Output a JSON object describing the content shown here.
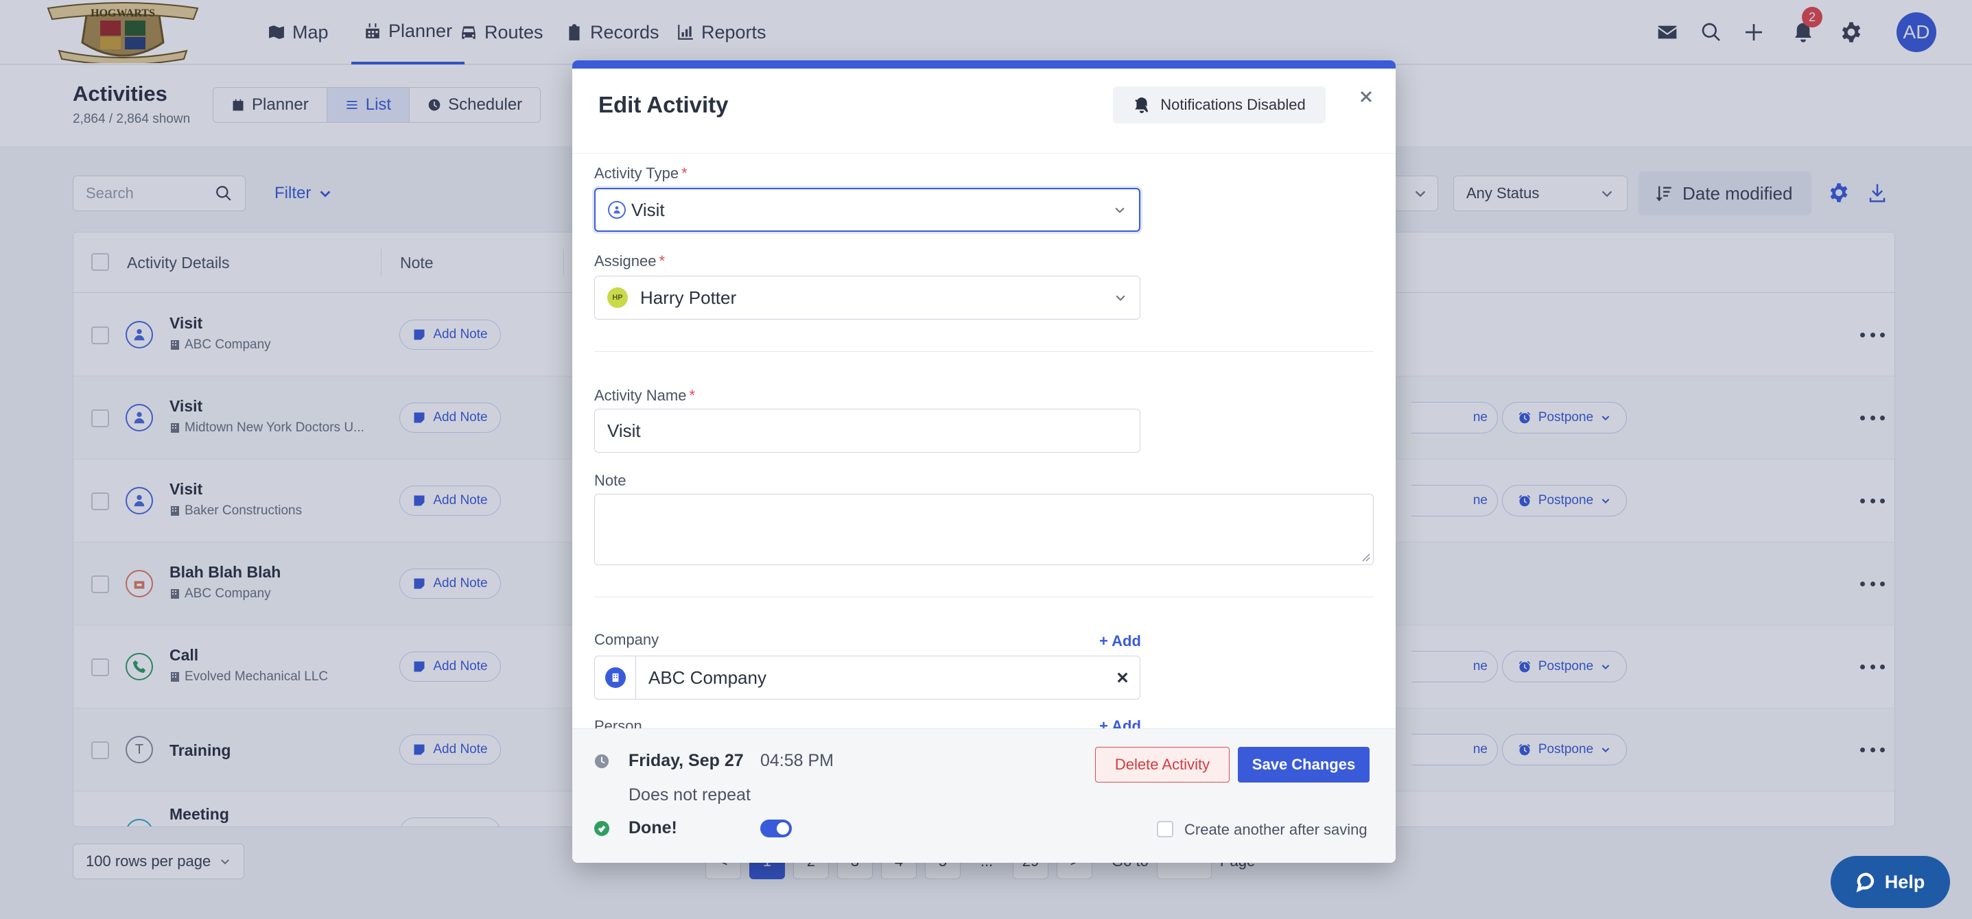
{
  "nav": {
    "items": [
      {
        "label": "Map",
        "icon": "map-icon"
      },
      {
        "label": "Planner",
        "icon": "calendar-icon",
        "active": true
      },
      {
        "label": "Routes",
        "icon": "car-icon"
      },
      {
        "label": "Records",
        "icon": "clipboard-icon"
      },
      {
        "label": "Reports",
        "icon": "chart-icon"
      }
    ],
    "notification_count": "2",
    "avatar_initials": "AD",
    "logo_text": "HOGWARTS"
  },
  "page": {
    "title": "Activities",
    "subtitle": "2,864 / 2,864 shown",
    "view_tabs": [
      {
        "label": "Planner",
        "icon": "calendar-icon"
      },
      {
        "label": "List",
        "icon": "list-icon",
        "active": true
      },
      {
        "label": "Scheduler",
        "icon": "clock-icon"
      }
    ]
  },
  "toolbar": {
    "search_placeholder": "Search",
    "filter_label": "Filter",
    "status_select": "Any Status",
    "sort_label": "Date modified"
  },
  "table": {
    "columns": [
      "Activity Details",
      "Note"
    ],
    "add_note_label": "Add Note",
    "done_partial": "ne",
    "postpone_label": "Postpone",
    "rows": [
      {
        "title": "Visit",
        "company": "ABC Company",
        "icon": "person-icon",
        "actions": false
      },
      {
        "title": "Visit",
        "company": "Midtown New York Doctors U...",
        "icon": "person-icon",
        "actions": true
      },
      {
        "title": "Visit",
        "company": "Baker Constructions",
        "icon": "person-icon",
        "actions": true
      },
      {
        "title": "Blah Blah Blah",
        "company": "ABC Company",
        "icon": "custom-activity-icon",
        "actions": false
      },
      {
        "title": "Call",
        "company": "Evolved Mechanical LLC",
        "icon": "phone-icon",
        "actions": true
      },
      {
        "title": "Training",
        "company": "",
        "icon": "letter-t-icon",
        "icon_text": "T",
        "actions": true
      },
      {
        "title": "Meeting",
        "company": "",
        "icon": "meeting-icon",
        "actions": false
      }
    ]
  },
  "footer": {
    "rows_per_page": "100 rows per page",
    "pages": [
      "1",
      "2",
      "3",
      "4",
      "5",
      "...",
      "29"
    ],
    "prev": "<",
    "next": ">",
    "goto_label": "Go to",
    "page_label": "Page"
  },
  "modal": {
    "title": "Edit Activity",
    "notifications_label": "Notifications Disabled",
    "activity_type_label": "Activity Type",
    "activity_type_value": "Visit",
    "assignee_label": "Assignee",
    "assignee_initials": "HP",
    "assignee_value": "Harry Potter",
    "activity_name_label": "Activity Name",
    "activity_name_value": "Visit",
    "note_label": "Note",
    "company_label": "Company",
    "company_add": "+ Add",
    "company_value": "ABC Company",
    "person_label": "Person",
    "person_add": "+ Add",
    "date": "Friday, Sep 27",
    "time": "04:58 PM",
    "repeat": "Does not repeat",
    "done_label": "Done!",
    "delete_label": "Delete Activity",
    "save_label": "Save Changes",
    "create_another_label": "Create another after saving"
  },
  "help": {
    "label": "Help"
  },
  "colors": {
    "accent": "#3a5bd9",
    "danger": "#e5484d",
    "success": "#2f9e63"
  }
}
